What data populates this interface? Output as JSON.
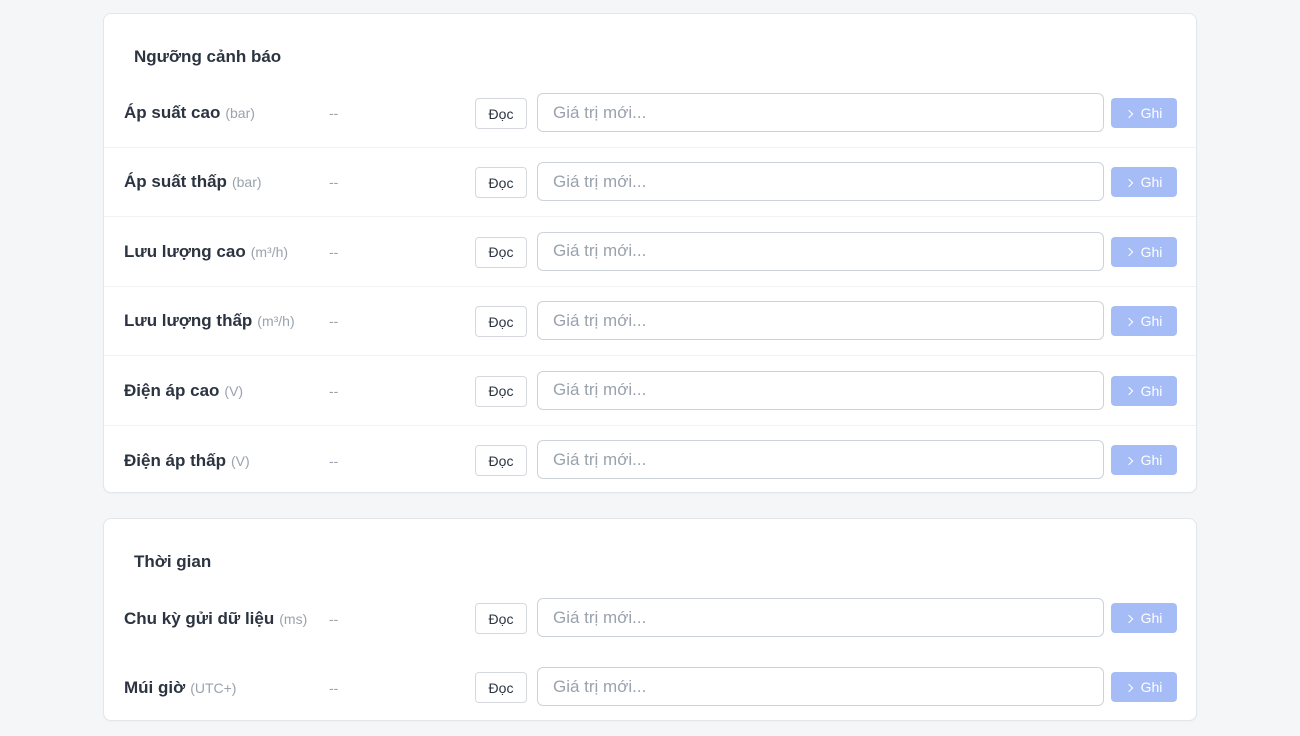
{
  "sections": [
    {
      "title": "Ngưỡng cảnh báo",
      "rows": [
        {
          "label": "Áp suất cao",
          "unit": "(bar)",
          "value": "--",
          "read_label": "Đọc",
          "placeholder": "Giá trị mới...",
          "write_label": "Ghi"
        },
        {
          "label": "Áp suất thấp",
          "unit": "(bar)",
          "value": "--",
          "read_label": "Đọc",
          "placeholder": "Giá trị mới...",
          "write_label": "Ghi"
        },
        {
          "label": "Lưu lượng cao",
          "unit": "(m³/h)",
          "value": "--",
          "read_label": "Đọc",
          "placeholder": "Giá trị mới...",
          "write_label": "Ghi"
        },
        {
          "label": "Lưu lượng thấp",
          "unit": "(m³/h)",
          "value": "--",
          "read_label": "Đọc",
          "placeholder": "Giá trị mới...",
          "write_label": "Ghi"
        },
        {
          "label": "Điện áp cao",
          "unit": "(V)",
          "value": "--",
          "read_label": "Đọc",
          "placeholder": "Giá trị mới...",
          "write_label": "Ghi"
        },
        {
          "label": "Điện áp thấp",
          "unit": "(V)",
          "value": "--",
          "read_label": "Đọc",
          "placeholder": "Giá trị mới...",
          "write_label": "Ghi"
        }
      ]
    },
    {
      "title": "Thời gian",
      "rows": [
        {
          "label": "Chu kỳ gửi dữ liệu",
          "unit": "(ms)",
          "value": "--",
          "read_label": "Đọc",
          "placeholder": "Giá trị mới...",
          "write_label": "Ghi"
        },
        {
          "label": "Múi giờ",
          "unit": "(UTC+)",
          "value": "--",
          "read_label": "Đọc",
          "placeholder": "Giá trị mới...",
          "write_label": "Ghi"
        }
      ]
    }
  ],
  "colors": {
    "page_bg": "#f5f6f8",
    "write_button_bg": "#a5bcf7",
    "muted_text": "#9aa2ad",
    "label_text": "#2b3440"
  },
  "icons": {
    "write_button_icon": "chevron-right-icon"
  }
}
